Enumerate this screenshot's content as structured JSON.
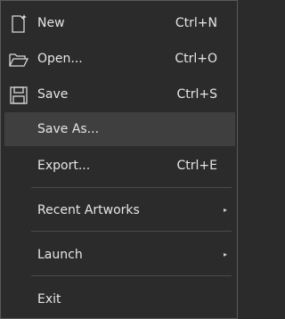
{
  "menu": {
    "items": [
      {
        "label": "New",
        "shortcut": "Ctrl+N",
        "icon": "new-document-icon"
      },
      {
        "label": "Open...",
        "shortcut": "Ctrl+O",
        "icon": "open-folder-icon"
      },
      {
        "label": "Save",
        "shortcut": "Ctrl+S",
        "icon": "save-disk-icon"
      },
      {
        "label": "Save As...",
        "shortcut": ""
      },
      {
        "label": "Export...",
        "shortcut": "Ctrl+E"
      },
      {
        "label": "Recent Artworks",
        "submenu": "▸"
      },
      {
        "label": "Launch",
        "submenu": "▸"
      },
      {
        "label": "Exit"
      }
    ]
  }
}
